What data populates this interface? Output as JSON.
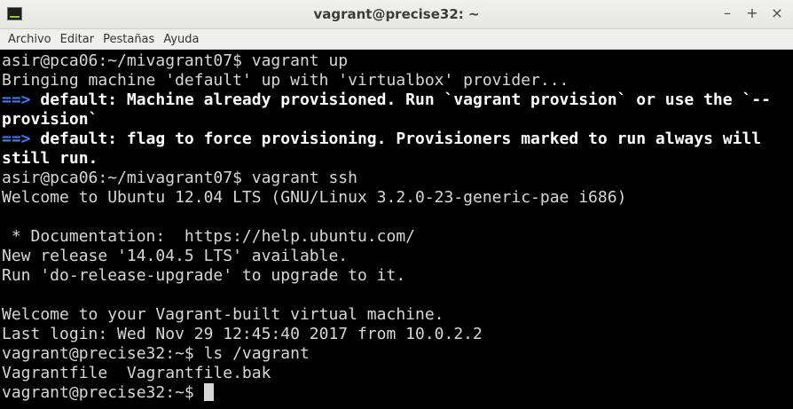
{
  "window": {
    "title": "vagrant@precise32: ~",
    "controls": {
      "minimize": "–",
      "maximize": "+",
      "close": "×"
    }
  },
  "menubar": {
    "items": [
      "Archivo",
      "Editar",
      "Pestañas",
      "Ayuda"
    ]
  },
  "terminal": {
    "lines": [
      {
        "kind": "out",
        "text": "asir@pca06:~/mivagrant07$ vagrant up"
      },
      {
        "kind": "out",
        "text": "Bringing machine 'default' up with 'virtualbox' provider..."
      },
      {
        "kind": "bold",
        "arrow": "==>",
        "text": " default: Machine already provisioned. Run `vagrant provision` or use the `--"
      },
      {
        "kind": "bold",
        "text": "provision`"
      },
      {
        "kind": "bold",
        "arrow": "==>",
        "text": " default: flag to force provisioning. Provisioners marked to run always will"
      },
      {
        "kind": "bold",
        "text": "still run."
      },
      {
        "kind": "out",
        "text": "asir@pca06:~/mivagrant07$ vagrant ssh"
      },
      {
        "kind": "out",
        "text": "Welcome to Ubuntu 12.04 LTS (GNU/Linux 3.2.0-23-generic-pae i686)"
      },
      {
        "kind": "out",
        "text": ""
      },
      {
        "kind": "out",
        "text": " * Documentation:  https://help.ubuntu.com/"
      },
      {
        "kind": "out",
        "text": "New release '14.04.5 LTS' available."
      },
      {
        "kind": "out",
        "text": "Run 'do-release-upgrade' to upgrade to it."
      },
      {
        "kind": "out",
        "text": ""
      },
      {
        "kind": "out",
        "text": "Welcome to your Vagrant-built virtual machine."
      },
      {
        "kind": "out",
        "text": "Last login: Wed Nov 29 12:45:40 2017 from 10.0.2.2"
      },
      {
        "kind": "out",
        "text": "vagrant@precise32:~$ ls /vagrant"
      },
      {
        "kind": "out",
        "text": "Vagrantfile  Vagrantfile.bak"
      },
      {
        "kind": "prompt",
        "text": "vagrant@precise32:~$ "
      }
    ]
  },
  "colors": {
    "terminal_bg": "#000000",
    "terminal_fg": "#d7d7d7",
    "arrow": "#3b7dff",
    "bold_fg": "#ffffff"
  }
}
